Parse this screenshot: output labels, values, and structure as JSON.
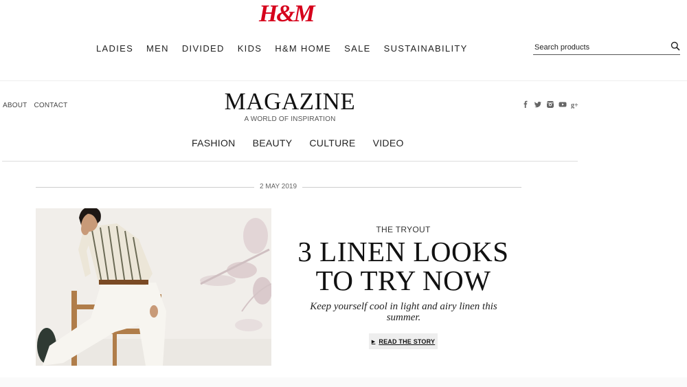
{
  "brand": {
    "logo_text": "H&M",
    "logo_color": "#d6001c"
  },
  "main_nav": [
    "LADIES",
    "MEN",
    "DIVIDED",
    "KIDS",
    "H&M HOME",
    "SALE",
    "SUSTAINABILITY"
  ],
  "search": {
    "placeholder": "Search products",
    "icon": "search-icon"
  },
  "magazine": {
    "top_links": [
      "ABOUT",
      "CONTACT"
    ],
    "title": "MAGAZINE",
    "subtitle": "A WORLD OF INSPIRATION",
    "social_icons": [
      "facebook-icon",
      "twitter-icon",
      "instagram-icon",
      "youtube-icon",
      "google-plus-icon"
    ],
    "sub_nav": [
      "FASHION",
      "BEAUTY",
      "CULTURE",
      "VIDEO"
    ]
  },
  "article": {
    "date": "2 MAY 2019",
    "kicker": "THE TRYOUT",
    "headline_line1": "3 LINEN LOOKS",
    "headline_line2": "TO TRY NOW",
    "deck": "Keep yourself cool in light and airy linen this summer.",
    "cta": "READ THE STORY"
  }
}
